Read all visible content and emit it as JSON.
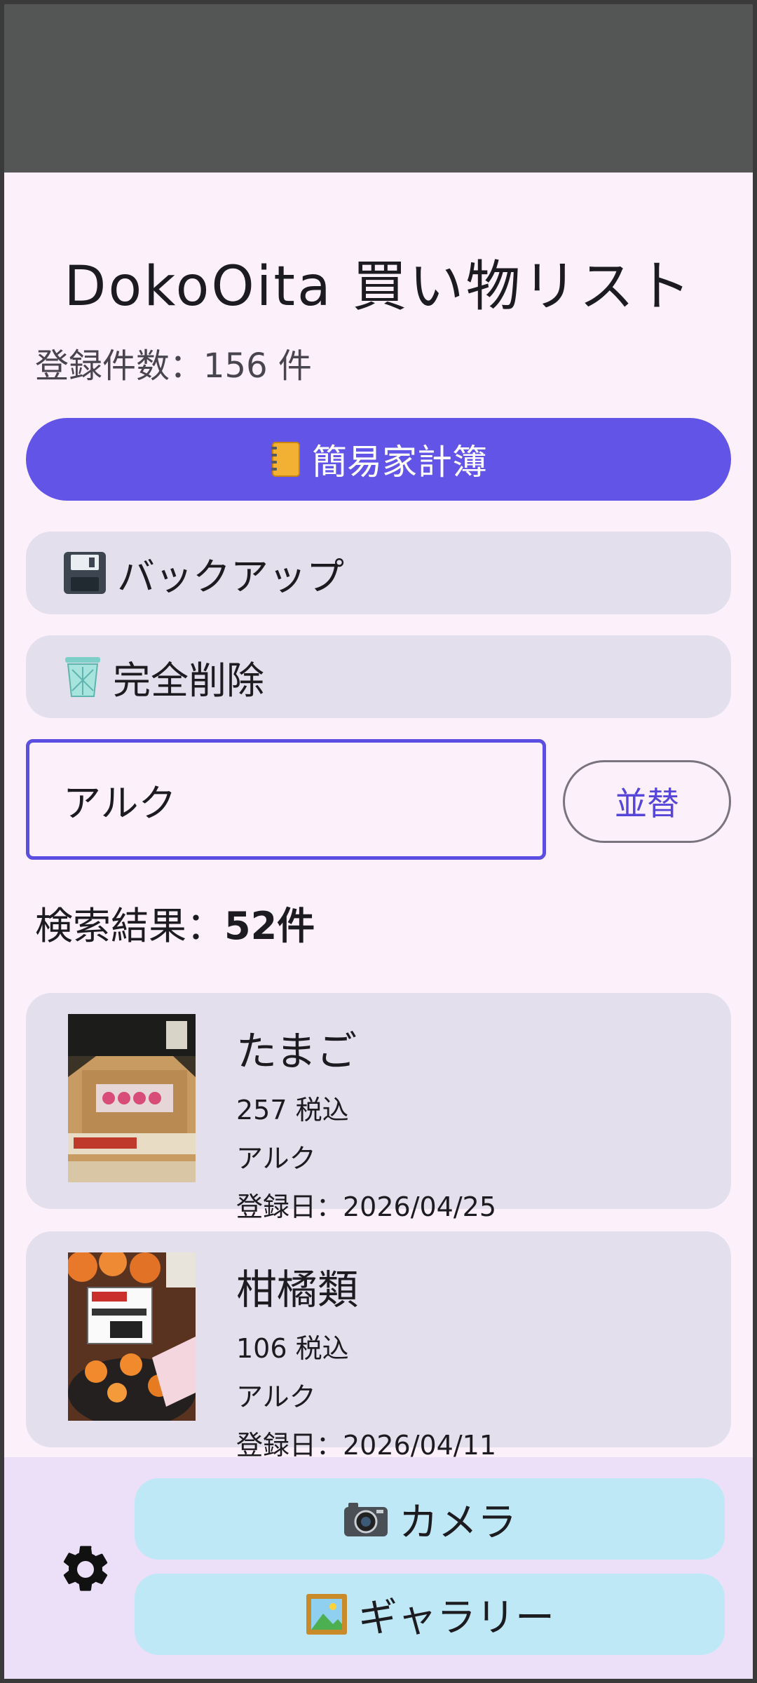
{
  "app": {
    "title": "DokoOita  買い物リスト",
    "count_text": "登録件数：156 件"
  },
  "actions": {
    "budget_label": "簡易家計簿",
    "budget_icon": "notebook-icon",
    "backup_label": "バックアップ",
    "backup_icon": "floppy-disk-icon",
    "delete_label": "完全削除",
    "delete_icon": "trash-bin-icon"
  },
  "search": {
    "value": "アルク",
    "sort_label": "並替"
  },
  "results": {
    "label": "検索結果：",
    "count": "52件"
  },
  "items": [
    {
      "name": "たまご",
      "price": "257 税込",
      "store": "アルク",
      "date": "登録日：2026/04/25"
    },
    {
      "name": "柑橘類",
      "price": "106 税込",
      "store": "アルク",
      "date": "登録日：2026/04/11"
    }
  ],
  "bottom": {
    "camera_label": "カメラ",
    "camera_icon": "camera-icon",
    "gallery_label": "ギャラリー",
    "gallery_icon": "framed-picture-icon",
    "settings_icon": "gear-icon"
  },
  "colors": {
    "primary": "#6354e8",
    "background": "#fcf0fa",
    "card": "#e3dfec",
    "bottom_button": "#bfe8f6"
  }
}
